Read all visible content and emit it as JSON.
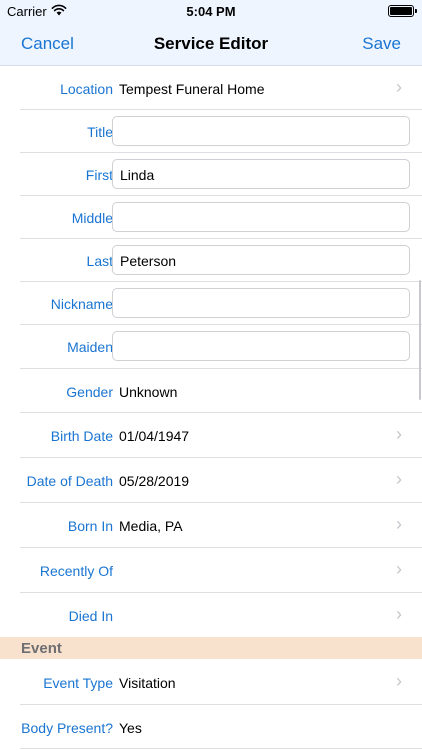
{
  "status_bar": {
    "carrier": "Carrier",
    "time": "5:04 PM",
    "battery_level": 1.0
  },
  "nav": {
    "cancel": "Cancel",
    "title": "Service Editor",
    "save": "Save"
  },
  "rows": [
    {
      "label": "Location",
      "value": "Tempest Funeral Home",
      "type": "disclosure"
    },
    {
      "label": "Title",
      "value": "",
      "type": "field"
    },
    {
      "label": "First",
      "value": "Linda",
      "type": "field"
    },
    {
      "label": "Middle",
      "value": "",
      "type": "field"
    },
    {
      "label": "Last",
      "value": "Peterson",
      "type": "field"
    },
    {
      "label": "Nickname",
      "value": "",
      "type": "field"
    },
    {
      "label": "Maiden",
      "value": "",
      "type": "field"
    },
    {
      "label": "Gender",
      "value": "Unknown",
      "type": "static"
    },
    {
      "label": "Birth Date",
      "value": "01/04/1947",
      "type": "disclosure"
    },
    {
      "label": "Date of Death",
      "value": "05/28/2019",
      "type": "disclosure"
    },
    {
      "label": "Born In",
      "value": "Media, PA",
      "type": "disclosure"
    },
    {
      "label": "Recently Of",
      "value": "",
      "type": "disclosure"
    },
    {
      "label": "Died In",
      "value": "",
      "type": "disclosure"
    }
  ],
  "event_section": {
    "title": "Event",
    "rows": [
      {
        "label": "Event Type",
        "value": "Visitation",
        "type": "disclosure"
      },
      {
        "label": "Body Present?",
        "value": "Yes",
        "type": "static"
      }
    ]
  },
  "icons": {
    "chevron": "chevron-right-icon",
    "wifi": "wifi-icon",
    "battery": "battery-icon"
  },
  "colors": {
    "accent": "#1a75d2",
    "nav_bg": "#eef5ff",
    "section_bg": "#f8e2cd"
  }
}
